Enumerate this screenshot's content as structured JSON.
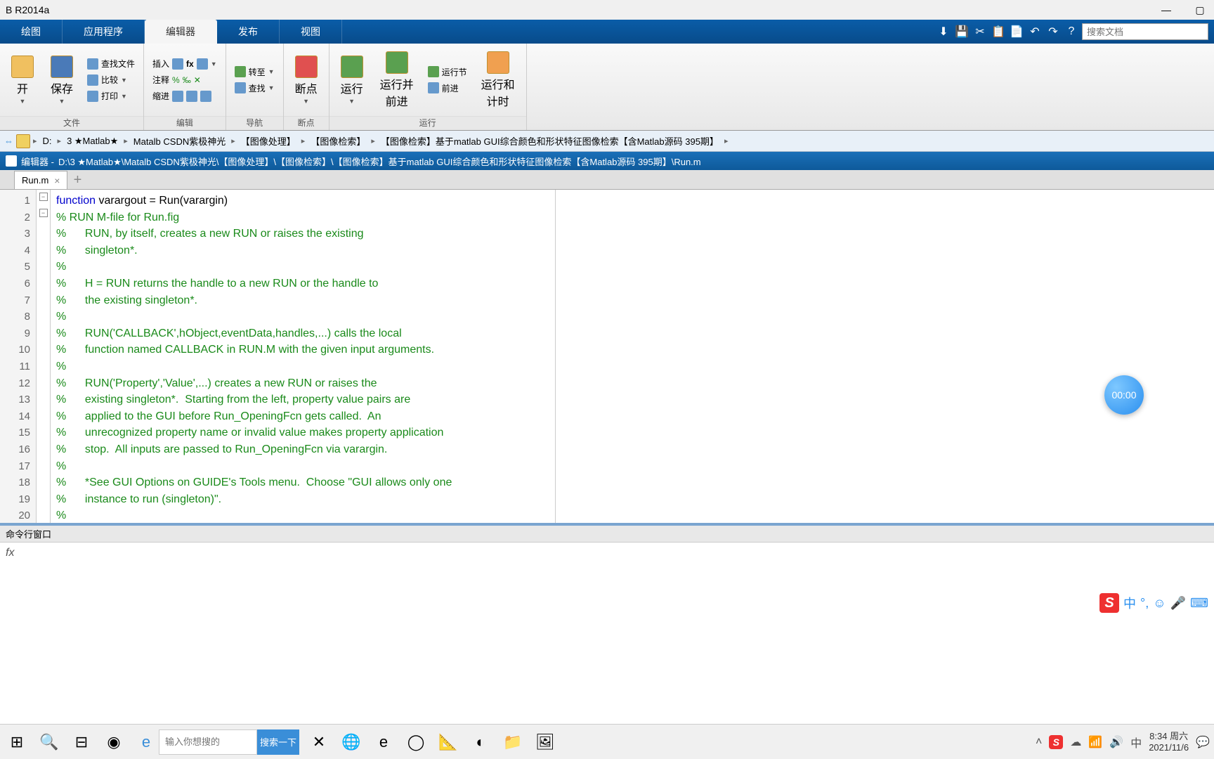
{
  "titlebar": {
    "title": "B R2014a"
  },
  "tabs": {
    "plot": "绘图",
    "apps": "应用程序",
    "editor": "编辑器",
    "publish": "发布",
    "view": "视图"
  },
  "qat": {
    "search_placeholder": "搜索文档"
  },
  "ribbon": {
    "open": "开",
    "save": "保存",
    "findfile": "查找文件",
    "compare": "比较",
    "print": "打印",
    "group_file": "文件",
    "insert": "插入",
    "comment": "注释",
    "indent": "缩进",
    "fx": "fx",
    "group_edit": "编辑",
    "goto": "转至",
    "find": "查找",
    "group_nav": "导航",
    "breakpoint": "断点",
    "group_bp": "断点",
    "run": "运行",
    "runadv": "运行并\n前进",
    "runsec": "运行节",
    "advance": "前进",
    "runtime": "运行和\n计时",
    "group_run": "运行"
  },
  "path": {
    "segs": [
      "D:",
      "3 ★Matlab★",
      "Matalb CSDN紫极神光",
      "【图像处理】",
      "【图像检索】",
      "【图像检索】基于matlab GUI综合颜色和形状特征图像检索【含Matlab源码 395期】"
    ]
  },
  "editor": {
    "title_prefix": "编辑器 - ",
    "filepath": "D:\\3 ★Matlab★\\Matalb CSDN紫极神光\\【图像处理】\\【图像检索】\\【图像检索】基于matlab GUI综合颜色和形状特征图像检索【含Matlab源码 395期】\\Run.m",
    "tab_name": "Run.m"
  },
  "code": [
    {
      "n": 1,
      "t": "function",
      "r": " varargout = Run(varargin)",
      "cls": "kw"
    },
    {
      "n": 2,
      "t": "% RUN M-file for Run.fig",
      "cls": "comment"
    },
    {
      "n": 3,
      "t": "%      RUN, by itself, creates a new RUN or raises the existing",
      "cls": "comment"
    },
    {
      "n": 4,
      "t": "%      singleton*.",
      "cls": "comment"
    },
    {
      "n": 5,
      "t": "%",
      "cls": "comment"
    },
    {
      "n": 6,
      "t": "%      H = RUN returns the handle to a new RUN or the handle to",
      "cls": "comment"
    },
    {
      "n": 7,
      "t": "%      the existing singleton*.",
      "cls": "comment"
    },
    {
      "n": 8,
      "t": "%",
      "cls": "comment"
    },
    {
      "n": 9,
      "t": "%      RUN('CALLBACK',hObject,eventData,handles,...) calls the local",
      "cls": "comment"
    },
    {
      "n": 10,
      "t": "%      function named CALLBACK in RUN.M with the given input arguments.",
      "cls": "comment"
    },
    {
      "n": 11,
      "t": "%",
      "cls": "comment"
    },
    {
      "n": 12,
      "t": "%      RUN('Property','Value',...) creates a new RUN or raises the",
      "cls": "comment"
    },
    {
      "n": 13,
      "t": "%      existing singleton*.  Starting from the left, property value pairs are",
      "cls": "comment"
    },
    {
      "n": 14,
      "t": "%      applied to the GUI before Run_OpeningFcn gets called.  An",
      "cls": "comment"
    },
    {
      "n": 15,
      "t": "%      unrecognized property name or invalid value makes property application",
      "cls": "comment"
    },
    {
      "n": 16,
      "t": "%      stop.  All inputs are passed to Run_OpeningFcn via varargin.",
      "cls": "comment"
    },
    {
      "n": 17,
      "t": "%",
      "cls": "comment"
    },
    {
      "n": 18,
      "t": "%      *See GUI Options on GUIDE's Tools menu.  Choose \"GUI allows only one",
      "cls": "comment"
    },
    {
      "n": 19,
      "t": "%      instance to run (singleton)\".",
      "cls": "comment"
    },
    {
      "n": 20,
      "t": "%",
      "cls": "comment"
    }
  ],
  "cmd": {
    "title": "命令行窗口",
    "prompt": "fx"
  },
  "timer": "00:00",
  "ime": {
    "char": "中"
  },
  "taskbar": {
    "search_placeholder": "输入你想搜的",
    "search_btn": "搜索一下",
    "time": "8:34 周六",
    "date": "2021/11/6"
  }
}
